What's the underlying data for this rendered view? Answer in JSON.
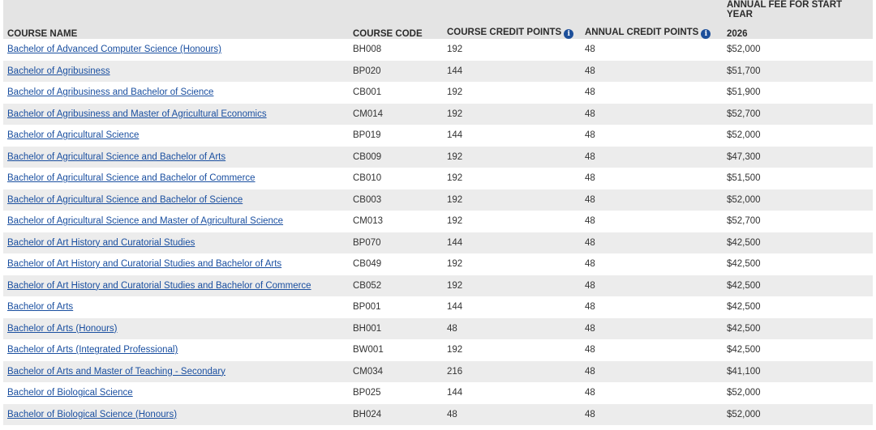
{
  "table": {
    "headers": {
      "course_name": "COURSE NAME",
      "course_code": "COURSE CODE",
      "course_credit_points": "COURSE CREDIT POINTS",
      "annual_credit_points": "ANNUAL CREDIT POINTS",
      "annual_fee": "ANNUAL FEE FOR START YEAR",
      "fee_year": "2026"
    },
    "info_glyph": "i",
    "rows": [
      {
        "name": "Bachelor of Advanced Computer Science (Honours)",
        "code": "BH008",
        "credit": "192",
        "annual": "48",
        "fee": "$52,000"
      },
      {
        "name": "Bachelor of Agribusiness",
        "code": "BP020",
        "credit": "144",
        "annual": "48",
        "fee": "$51,700"
      },
      {
        "name": "Bachelor of Agribusiness and Bachelor of Science",
        "code": "CB001",
        "credit": "192",
        "annual": "48",
        "fee": "$51,900"
      },
      {
        "name": "Bachelor of Agribusiness and Master of Agricultural Economics",
        "code": "CM014",
        "credit": "192",
        "annual": "48",
        "fee": "$52,700"
      },
      {
        "name": "Bachelor of Agricultural Science",
        "code": "BP019",
        "credit": "144",
        "annual": "48",
        "fee": "$52,000"
      },
      {
        "name": "Bachelor of Agricultural Science and Bachelor of Arts",
        "code": "CB009",
        "credit": "192",
        "annual": "48",
        "fee": "$47,300"
      },
      {
        "name": "Bachelor of Agricultural Science and Bachelor of Commerce",
        "code": "CB010",
        "credit": "192",
        "annual": "48",
        "fee": "$51,500"
      },
      {
        "name": "Bachelor of Agricultural Science and Bachelor of Science",
        "code": "CB003",
        "credit": "192",
        "annual": "48",
        "fee": "$52,000"
      },
      {
        "name": "Bachelor of Agricultural Science and Master of Agricultural Science",
        "code": "CM013",
        "credit": "192",
        "annual": "48",
        "fee": "$52,700"
      },
      {
        "name": "Bachelor of Art History and Curatorial Studies",
        "code": "BP070",
        "credit": "144",
        "annual": "48",
        "fee": "$42,500"
      },
      {
        "name": "Bachelor of Art History and Curatorial Studies and Bachelor of Arts",
        "code": "CB049",
        "credit": "192",
        "annual": "48",
        "fee": "$42,500"
      },
      {
        "name": "Bachelor of Art History and Curatorial Studies and Bachelor of Commerce",
        "code": "CB052",
        "credit": "192",
        "annual": "48",
        "fee": "$42,500"
      },
      {
        "name": "Bachelor of Arts",
        "code": "BP001",
        "credit": "144",
        "annual": "48",
        "fee": "$42,500"
      },
      {
        "name": "Bachelor of Arts (Honours)",
        "code": "BH001",
        "credit": "48",
        "annual": "48",
        "fee": "$42,500"
      },
      {
        "name": "Bachelor of Arts (Integrated Professional)",
        "code": "BW001",
        "credit": "192",
        "annual": "48",
        "fee": "$42,500"
      },
      {
        "name": "Bachelor of Arts and Master of Teaching - Secondary",
        "code": "CM034",
        "credit": "216",
        "annual": "48",
        "fee": "$41,100"
      },
      {
        "name": "Bachelor of Biological Science",
        "code": "BP025",
        "credit": "144",
        "annual": "48",
        "fee": "$52,000"
      },
      {
        "name": "Bachelor of Biological Science (Honours)",
        "code": "BH024",
        "credit": "48",
        "annual": "48",
        "fee": "$52,000"
      }
    ]
  }
}
